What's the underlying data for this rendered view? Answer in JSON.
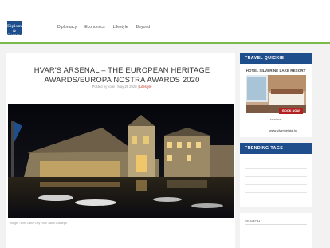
{
  "header": {
    "logo_text": "Diplomacy & Commerce",
    "nav": [
      "Diplomacy",
      "Economics",
      "Lifestyle",
      "Beyond"
    ]
  },
  "article": {
    "title": "HVAR'S ARSENAL – THE EUROPEAN HERITAGE AWARDS/EUROPA NOSTRA AWARDS 2020",
    "meta_prefix": "Posted by ",
    "author": "kolie",
    "date": "May 26 2020",
    "category": "Lifestyle",
    "caption": "Image: Turist Office City Hvar Jakov Kavanjin"
  },
  "sidebar": {
    "travel_head": "TRAVEL QUICKIE",
    "ad_title": "HOTEL SILVERINE LAKE RESORT",
    "ad_button": "BOOK NOW",
    "ad_logo": "SILVERINE",
    "ad_url": "www.silverinelake.hu",
    "tags_head": "TRENDING TAGS",
    "search_label": "SEARCH ..."
  },
  "colors": {
    "brand_blue": "#1f4e8c",
    "accent_green": "#7bbb4a",
    "book_red": "#b22222"
  }
}
